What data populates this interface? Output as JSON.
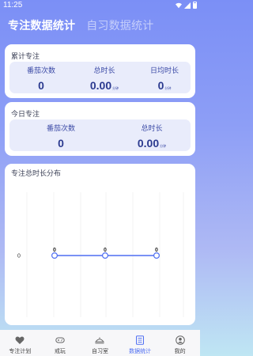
{
  "status": {
    "time": "11:25"
  },
  "tabs": [
    {
      "label": "专注数据统计",
      "active": true
    },
    {
      "label": "自习数据统计",
      "active": false
    }
  ],
  "cumulative": {
    "title": "累计专注",
    "stats": [
      {
        "label": "番茄次数",
        "value": "0",
        "unit": ""
      },
      {
        "label": "总时长",
        "value": "0.00",
        "unit": "分钟"
      },
      {
        "label": "日均时长",
        "value": "0",
        "unit": "分钟"
      }
    ]
  },
  "today": {
    "title": "今日专注",
    "stats": [
      {
        "label": "番茄次数",
        "value": "0",
        "unit": ""
      },
      {
        "label": "总时长",
        "value": "0.00",
        "unit": "分钟"
      }
    ]
  },
  "distribution": {
    "title": "专注总时长分布"
  },
  "chart_data": {
    "type": "line",
    "title": "专注总时长分布",
    "x": [
      1,
      2,
      3
    ],
    "series": [
      {
        "values": [
          0,
          0,
          0
        ]
      }
    ],
    "ytick_labels": [
      "0"
    ],
    "data_labels": [
      "0",
      "0",
      "0"
    ],
    "grid": true,
    "color": "#4f6ff2"
  },
  "nav": [
    {
      "label": "专注计划",
      "icon": "heart-icon",
      "active": false
    },
    {
      "label": "戒玩",
      "icon": "gamepad-icon",
      "active": false
    },
    {
      "label": "自习室",
      "icon": "room-icon",
      "active": false
    },
    {
      "label": "数据统计",
      "icon": "stats-icon",
      "active": true
    },
    {
      "label": "我的",
      "icon": "profile-icon",
      "active": false
    }
  ]
}
